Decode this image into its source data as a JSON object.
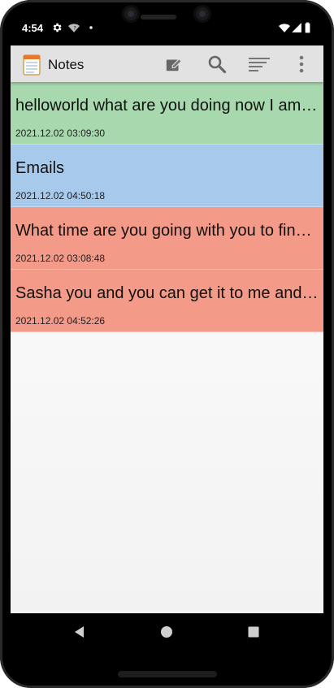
{
  "status": {
    "time": "4:54"
  },
  "appbar": {
    "title": "Notes",
    "icons": [
      "app-logo-icon",
      "edit-icon",
      "search-icon",
      "sort-icon",
      "more-vert-icon"
    ]
  },
  "notes": [
    {
      "title": "helloworld what are you doing now I am going to the store",
      "date": "2021.12.02 03:09:30",
      "color": "#a8d8ae"
    },
    {
      "title": "Emails",
      "date": "2021.12.02 04:50:18",
      "color": "#a7c9ec"
    },
    {
      "title": "What time are you going with you to find a way to the store",
      "date": "2021.12.02 03:08:48",
      "color": "#f49a88"
    },
    {
      "title": "Sasha you and you can get it to me and I will be there",
      "date": "2021.12.02 04:52:26",
      "color": "#f49a88"
    }
  ],
  "navbar": {
    "icons": [
      "back-icon",
      "home-icon",
      "recents-icon"
    ]
  }
}
